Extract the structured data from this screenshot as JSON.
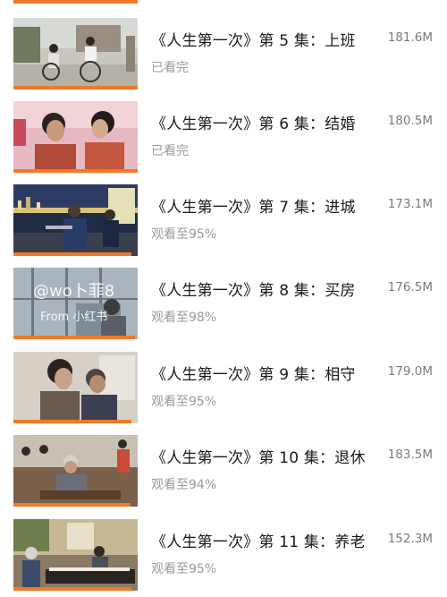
{
  "episodes": [
    {
      "title": "《人生第一次》第 5 集：上班",
      "size": "181.6M",
      "status": "已看完",
      "progress": 1.0
    },
    {
      "title": "《人生第一次》第 6 集：结婚",
      "size": "180.5M",
      "status": "已看完",
      "progress": 1.0
    },
    {
      "title": "《人生第一次》第 7 集：进城",
      "size": "173.1M",
      "status": "观看至95%",
      "progress": 0.95
    },
    {
      "title": "《人生第一次》第 8 集：买房",
      "size": "176.5M",
      "status": "观看至98%",
      "progress": 0.98
    },
    {
      "title": "《人生第一次》第 9 集：相守",
      "size": "179.0M",
      "status": "观看至95%",
      "progress": 0.95
    },
    {
      "title": "《人生第一次》第 10 集：退休",
      "size": "183.5M",
      "status": "观看至94%",
      "progress": 0.94
    },
    {
      "title": "《人生第一次》第 11 集：养老",
      "size": "152.3M",
      "status": "观看至95%",
      "progress": 0.95
    }
  ],
  "watermark": {
    "handle": "@wo卜菲8",
    "source": "From 小红书"
  },
  "colors": {
    "accent": "#f07a2a"
  }
}
